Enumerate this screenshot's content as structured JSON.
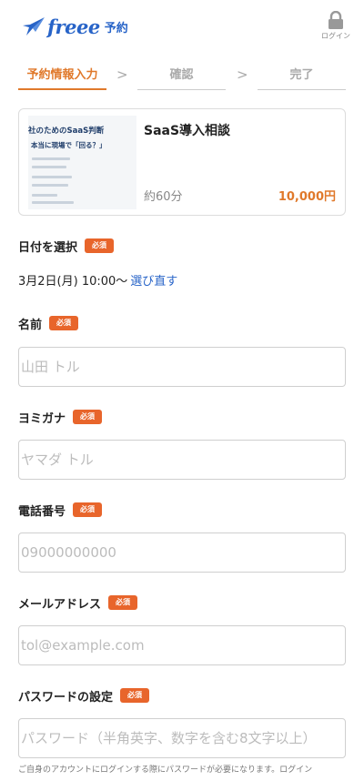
{
  "header": {
    "logo_word": "freee",
    "logo_sub": "予約",
    "login_label": "ログイン"
  },
  "steps": [
    {
      "label": "予約情報入力",
      "active": true
    },
    {
      "label": "確認",
      "active": false
    },
    {
      "label": "完了",
      "active": false
    }
  ],
  "step_separator": ">",
  "service": {
    "thumbnail_title": "社のためのSaaS判断",
    "thumbnail_subtitle": "本当に現場で「回る？」",
    "name": "SaaS導入相談",
    "duration": "約60分",
    "price": "10,000円"
  },
  "form": {
    "required_badge": "必須",
    "date": {
      "label": "日付を選択",
      "value": "3月2日(月) 10:00〜",
      "change_link": "選び直す"
    },
    "name": {
      "label": "名前",
      "placeholder": "山田 トル"
    },
    "kana": {
      "label": "ヨミガナ",
      "placeholder": "ヤマダ トル"
    },
    "phone": {
      "label": "電話番号",
      "placeholder": "09000000000"
    },
    "email": {
      "label": "メールアドレス",
      "placeholder": "tol@example.com"
    },
    "password": {
      "label": "パスワードの設定",
      "placeholder": "パスワード（半角英字、数字を含む8文字以上）",
      "hint": "ご自身のアカウントにログインする際にパスワードが必要になります。ログイン"
    }
  },
  "colors": {
    "brand_blue": "#2864c8",
    "accent_orange": "#e0792b",
    "badge_orange": "#e8652b"
  }
}
